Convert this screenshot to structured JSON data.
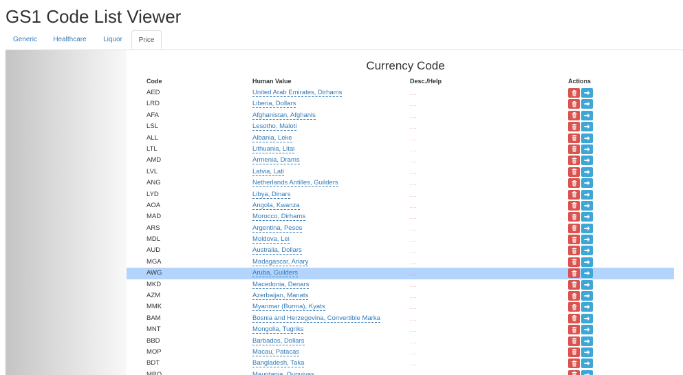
{
  "app": {
    "title": "GS1 Code List Viewer"
  },
  "tabs": [
    {
      "label": "Generic",
      "active": false
    },
    {
      "label": "Healthcare",
      "active": false
    },
    {
      "label": "Liquor",
      "active": false
    },
    {
      "label": "Price",
      "active": true
    }
  ],
  "table": {
    "title": "Currency Code",
    "columns": {
      "code": "Code",
      "human": "Human Value",
      "desc": "Desc./Help",
      "actions": "Actions"
    },
    "desc_placeholder": "...",
    "rows": [
      {
        "code": "AED",
        "human": "United Arab Emirates, Dirhams",
        "selected": false
      },
      {
        "code": "LRD",
        "human": "Liberia, Dollars",
        "selected": false
      },
      {
        "code": "AFA",
        "human": "Afghanistan, Afghanis",
        "selected": false
      },
      {
        "code": "LSL",
        "human": "Lesotho, Maloti",
        "selected": false
      },
      {
        "code": "ALL",
        "human": "Albania, Leke",
        "selected": false
      },
      {
        "code": "LTL",
        "human": "Lithuania, Litai",
        "selected": false
      },
      {
        "code": "AMD",
        "human": "Armenia, Drams",
        "selected": false
      },
      {
        "code": "LVL",
        "human": "Latvia, Lati",
        "selected": false
      },
      {
        "code": "ANG",
        "human": "Netherlands Antilles, Guilders",
        "selected": false
      },
      {
        "code": "LYD",
        "human": "Libya, Dinars",
        "selected": false
      },
      {
        "code": "AOA",
        "human": "Angola, Kwanza",
        "selected": false
      },
      {
        "code": "MAD",
        "human": "Morocco, Dirhams",
        "selected": false
      },
      {
        "code": "ARS",
        "human": "Argentina, Pesos",
        "selected": false
      },
      {
        "code": "MDL",
        "human": "Moldova, Lei",
        "selected": false
      },
      {
        "code": "AUD",
        "human": "Australia, Dollars",
        "selected": false
      },
      {
        "code": "MGA",
        "human": "Madagascar, Ariary",
        "selected": false
      },
      {
        "code": "AWG",
        "human": "Aruba, Guilders",
        "selected": true
      },
      {
        "code": "MKD",
        "human": "Macedonia, Denars",
        "selected": false
      },
      {
        "code": "AZM",
        "human": "Azerbaijan, Manats",
        "selected": false
      },
      {
        "code": "MMK",
        "human": "Myanmar (Burma), Kyats",
        "selected": false
      },
      {
        "code": "BAM",
        "human": "Bosnia and Herzegovina, Convertible Marka",
        "selected": false
      },
      {
        "code": "MNT",
        "human": "Mongolia, Tugriks",
        "selected": false
      },
      {
        "code": "BBD",
        "human": "Barbados, Dollars",
        "selected": false
      },
      {
        "code": "MOP",
        "human": "Macau, Patacas",
        "selected": false
      },
      {
        "code": "BDT",
        "human": "Bangladesh, Taka",
        "selected": false
      },
      {
        "code": "MRO",
        "human": "Mauritania, Ouguiyas",
        "selected": false
      }
    ]
  },
  "icons": {
    "delete": "trash-icon",
    "go": "arrow-right-icon"
  },
  "colors": {
    "link": "#337ab7",
    "delete": "#d9534f",
    "go": "#3fa7d6",
    "selected_row": "#b3d4fc"
  }
}
